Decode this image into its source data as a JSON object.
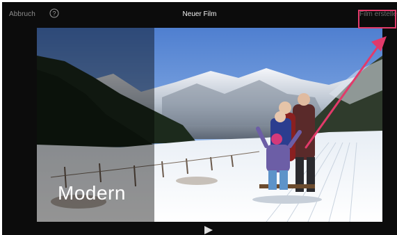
{
  "header": {
    "cancel_label": "Abbruch",
    "help_icon": "help-circle-icon",
    "title": "Neuer Film",
    "create_label": "Film erstellen"
  },
  "preview": {
    "theme_label": "Modern",
    "play_icon": "play-icon"
  },
  "colors": {
    "background": "#0c0c0c",
    "annotation": "#e23a6a",
    "title_text": "#f2f2f2",
    "secondary_text": "#8d8d8d"
  }
}
